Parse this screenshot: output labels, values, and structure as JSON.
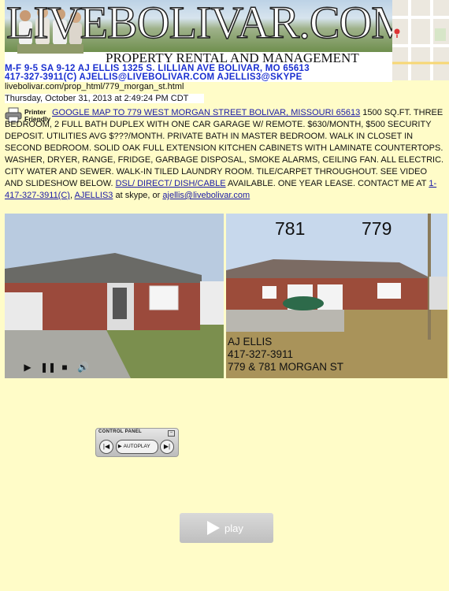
{
  "banner": {
    "logo": "LIVEBOLIVAR.COM",
    "subtitle": "PROPERTY RENTAL AND MANAGEMENT",
    "line1": "M-F 9-5  SA 9-12  AJ ELLIS 1325 S. LILLIAN AVE BOLIVAR, MO 65613",
    "line2": "417-327-3911(C)   AJELLIS@LIVEBOLIVAR.COM   AJELLIS3@SKYPE"
  },
  "page": {
    "url": "livebolivar.com/prop_html/779_morgan_st.html",
    "datetime": "Thursday, October 31, 2013 at 2:49:24 PM CDT"
  },
  "printer": {
    "label_line1": "Printer",
    "label_line2": "Friendly"
  },
  "listing": {
    "map_link": "GOOGLE MAP TO 779 WEST MORGAN STREET BOLIVAR, MISSOURI 65613",
    "description": " 1500 SQ.FT. THREE BEDROOM, 2 FULL BATH DUPLEX WITH ONE CAR GARAGE W/ REMOTE.  $630/MONTH, $500 SECURITY DEPOSIT.  UTILITIES AVG $???/MONTH.  PRIVATE BATH IN MASTER BEDROOM.  WALK IN CLOSET IN SECOND BEDROOM.  SOLID OAK FULL EXTENSION KITCHEN CABINETS WITH LAMINATE COUNTERTOPS.  WASHER, DRYER, RANGE, FRIDGE, GARBAGE DISPOSAL, SMOKE ALARMS, CEILING FAN.  ALL ELECTRIC. CITY WATER AND SEWER.  WALK-IN TILED LAUNDRY ROOM.  TILE/CARPET THROUGHOUT. SEE VIDEO AND SLIDESHOW BELOW. ",
    "dsl_link": "DSL/ DIRECT/ DISH/CABLE",
    "available_text": " AVAILABLE.  ONE YEAR LEASE.  CONTACT ME AT ",
    "phone_link": "1-417-327-3911(C)",
    "comma": ",  ",
    "skype_link": "AJELLIS3",
    "skype_text": " at skype, or ",
    "email_link": "ajellis@livebolivar.com"
  },
  "photo_right": {
    "unit_left": "781",
    "unit_right": "779",
    "caption_line1": "AJ ELLIS",
    "caption_line2": "417-327-3911",
    "caption_line3": "779 & 781 MORGAN ST"
  },
  "control_panel": {
    "title": "CONTROL PANEL",
    "autoplay": "AUTOPLAY"
  },
  "play": {
    "label": "play"
  },
  "colors": {
    "page_bg": "#fffcc8",
    "link": "#1a1aa6",
    "banner_text": "#1a2fd0"
  }
}
